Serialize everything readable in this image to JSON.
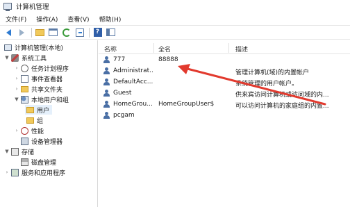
{
  "window": {
    "title": "计算机管理",
    "app_icon": "computer-management-icon"
  },
  "menu": [
    {
      "label": "文件(F)"
    },
    {
      "label": "操作(A)"
    },
    {
      "label": "查看(V)"
    },
    {
      "label": "帮助(H)"
    }
  ],
  "toolbar": [
    {
      "icon": "back-arrow-icon"
    },
    {
      "icon": "forward-arrow-icon"
    },
    {
      "icon": "up-folder-icon"
    },
    {
      "icon": "show-console-tree-icon"
    },
    {
      "icon": "refresh-icon"
    },
    {
      "icon": "export-list-icon"
    },
    {
      "icon": "help-icon"
    },
    {
      "icon": "show-action-pane-icon"
    }
  ],
  "tree": {
    "root": "计算机管理(本地)",
    "system_tools": "系统工具",
    "task_scheduler": "任务计划程序",
    "event_viewer": "事件查看器",
    "shared_folders": "共享文件夹",
    "local_users_groups": "本地用户和组",
    "users": "用户",
    "groups": "组",
    "performance": "性能",
    "device_manager": "设备管理器",
    "storage": "存储",
    "disk_management": "磁盘管理",
    "services_apps": "服务和应用程序"
  },
  "list": {
    "columns": {
      "name": "名称",
      "full_name": "全名",
      "description": "描述"
    },
    "rows": [
      {
        "name": "777",
        "full_name": "88888",
        "description": ""
      },
      {
        "name": "Administrat...",
        "full_name": "",
        "description": "管理计算机(域)的内置帐户"
      },
      {
        "name": "DefaultAcc...",
        "full_name": "",
        "description": "系统管理的用户帐户。"
      },
      {
        "name": "Guest",
        "full_name": "",
        "description": "供来宾访问计算机或访问域的内..."
      },
      {
        "name": "HomeGrou...",
        "full_name": "HomeGroupUser$",
        "description": "可以访问计算机的家庭组的内置..."
      },
      {
        "name": "pcgam",
        "full_name": "",
        "description": ""
      }
    ]
  },
  "colors": {
    "accent": "#2f7bd1",
    "annotation_arrow": "#e23a2e",
    "selection": "#e5f0fb"
  }
}
